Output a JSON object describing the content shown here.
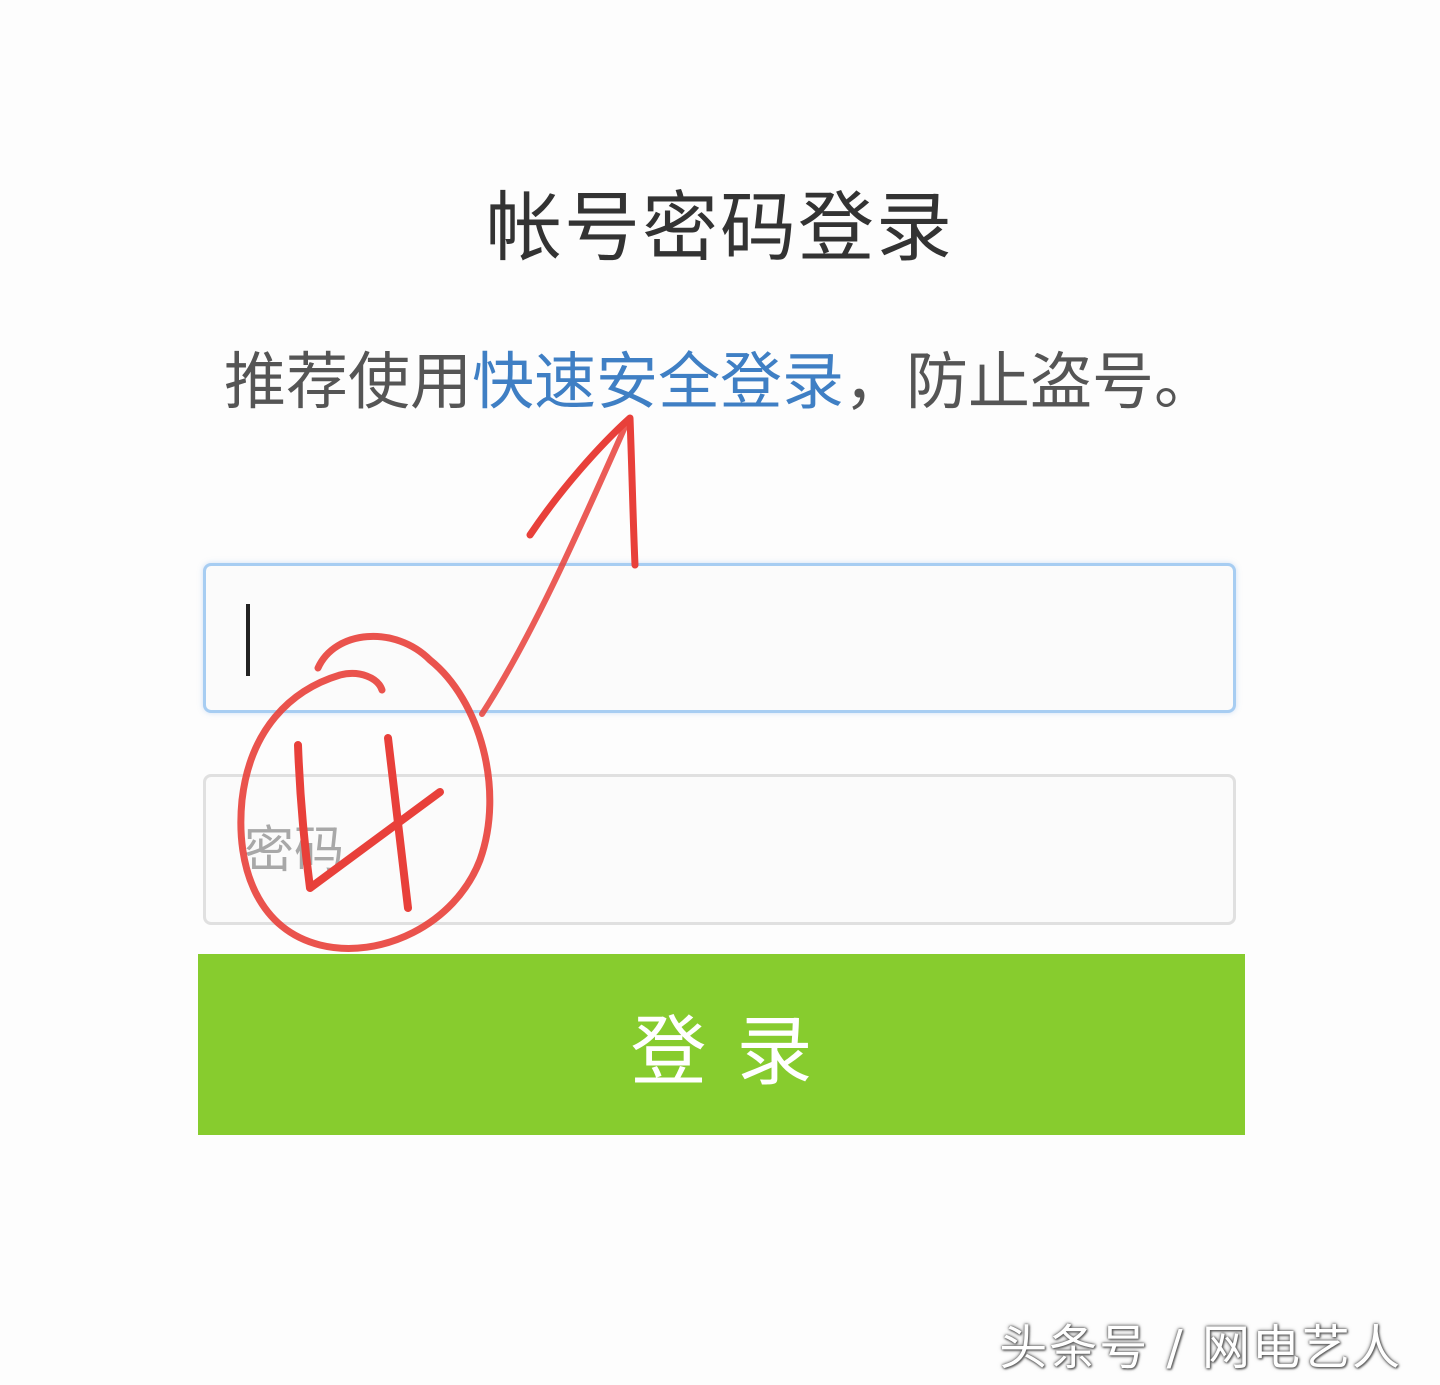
{
  "header": {
    "title": "帐号密码登录"
  },
  "notice": {
    "prefix": "推荐使用",
    "link_text": "快速安全登录",
    "suffix": "，防止盗号。"
  },
  "form": {
    "username_value": "",
    "password_placeholder": "密码",
    "submit_label": "登录"
  },
  "annotation": {
    "step_number": "4",
    "color": "#e8403a"
  },
  "watermark": {
    "text": "头条号 / 网电艺人"
  },
  "colors": {
    "accent_green": "#87cc2e",
    "link_blue": "#3f7fc4",
    "focus_border": "#a7cdf2"
  }
}
